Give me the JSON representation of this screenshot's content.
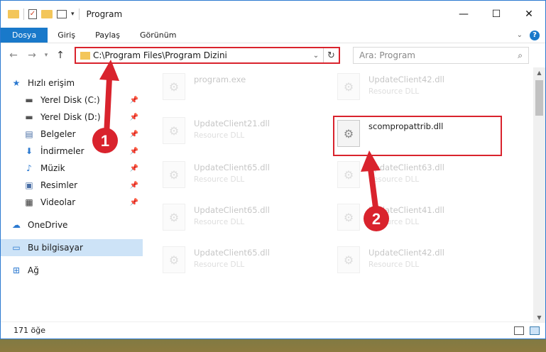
{
  "title_bar": {
    "title": "Program"
  },
  "ribbon": {
    "tabs": [
      "Dosya",
      "Giriş",
      "Paylaş",
      "Görünüm"
    ]
  },
  "address": {
    "path": "C:\\Program Files\\Program Dizini"
  },
  "search": {
    "placeholder": "Ara: Program"
  },
  "sidebar": {
    "items": [
      {
        "label": "Hızlı erişim",
        "icon": "star-icon"
      },
      {
        "label": "Yerel Disk (C:)",
        "icon": "drive-icon",
        "pinned": true
      },
      {
        "label": "Yerel Disk (D:)",
        "icon": "drive-icon",
        "pinned": true
      },
      {
        "label": "Belgeler",
        "icon": "documents-icon",
        "pinned": true
      },
      {
        "label": "İndirmeler",
        "icon": "download-icon",
        "pinned": true
      },
      {
        "label": "Müzik",
        "icon": "music-icon",
        "pinned": true
      },
      {
        "label": "Resimler",
        "icon": "pictures-icon",
        "pinned": true
      },
      {
        "label": "Videolar",
        "icon": "videos-icon",
        "pinned": true
      },
      {
        "label": "OneDrive",
        "icon": "cloud-icon"
      },
      {
        "label": "Bu bilgisayar",
        "icon": "computer-icon",
        "selected": true
      },
      {
        "label": "Ağ",
        "icon": "network-icon"
      }
    ]
  },
  "files": [
    {
      "name": "program.exe",
      "desc": ""
    },
    {
      "name": "UpdateClient42.dll",
      "desc": "Resource DLL"
    },
    {
      "name": "UpdateClient21.dll",
      "desc": "Resource DLL"
    },
    {
      "name": "scompropattrib.dll",
      "desc": ""
    },
    {
      "name": "UpdateClient65.dll",
      "desc": "Resource DLL"
    },
    {
      "name": "UpdateClient63.dll",
      "desc": "Resource DLL"
    },
    {
      "name": "UpdateClient65.dll",
      "desc": "Resource DLL"
    },
    {
      "name": "UpdateClient41.dll",
      "desc": "Resource DLL"
    },
    {
      "name": "UpdateClient65.dll",
      "desc": "Resource DLL"
    },
    {
      "name": "UpdateClient42.dll",
      "desc": "Resource DLL"
    }
  ],
  "status": {
    "count": "171 öğe"
  },
  "annotations": {
    "one": "1",
    "two": "2"
  },
  "colors": {
    "accent": "#1979ca",
    "highlight": "#d9232d"
  }
}
